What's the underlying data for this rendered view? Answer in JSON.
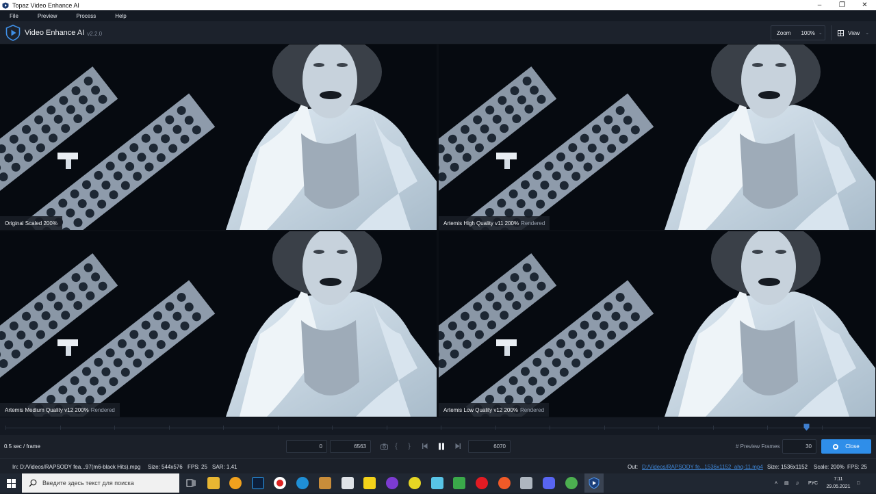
{
  "window": {
    "title": "Topaz Video Enhance AI"
  },
  "menu": [
    "File",
    "Preview",
    "Process",
    "Help"
  ],
  "app": {
    "name": "Video Enhance AI",
    "version": "v2.2.0"
  },
  "toolbar": {
    "zoom_label": "Zoom",
    "zoom_value": "100%",
    "view_label": "View"
  },
  "panes": [
    {
      "label": "Original Scaled 200%",
      "status": ""
    },
    {
      "label": "Artemis High Quality v11 200%",
      "status": "Rendered"
    },
    {
      "label": "Artemis Medium Quality v12 200%",
      "status": "Rendered"
    },
    {
      "label": "Artemis Low Quality v12 200%",
      "status": "Rendered"
    }
  ],
  "timeline": {
    "marker_position": 0.926
  },
  "controls": {
    "rate": "0.5 sec / frame",
    "start_frame": "0",
    "end_frame": "6563",
    "current_frame": "6070",
    "preview_frames_label": "# Preview Frames",
    "preview_frames_value": "30",
    "close_label": "Close"
  },
  "info": {
    "in_path": "In:  D:/Videos/RAPSODY fea...97(m6-black Hits).mpg",
    "in_size": "Size: 544x576",
    "in_fps": "FPS: 25",
    "in_sar": "SAR: 1.41",
    "out_label": "Out:",
    "out_path": "D:/Videos/RAPSODY fe...1536x1152_ahq-11.mp4",
    "out_size": "Size: 1536x1152",
    "out_scale": "Scale: 200%",
    "out_fps": "FPS: 25"
  },
  "taskbar": {
    "search_placeholder": "Введите здесь текст для поиска",
    "language": "РУС",
    "time": "7:11",
    "date": "29.05.2021"
  },
  "colors": {
    "accent": "#2f8ee9",
    "background": "#1b2029",
    "link": "#3f86d6"
  }
}
